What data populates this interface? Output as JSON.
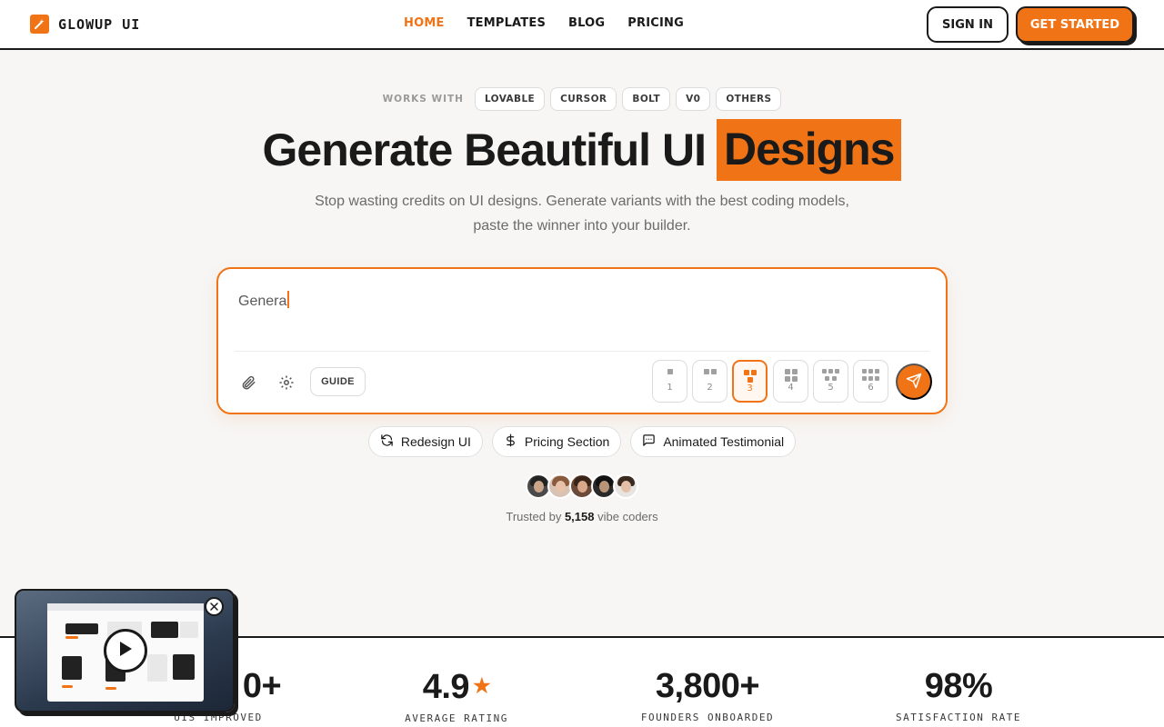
{
  "header": {
    "brand": "GLOWUP UI",
    "nav": [
      "HOME",
      "TEMPLATES",
      "BLOG",
      "PRICING"
    ],
    "active_nav": "HOME",
    "signin_label": "SIGN IN",
    "cta_label": "GET STARTED"
  },
  "works_with": {
    "label": "WORKS WITH",
    "chips": [
      "LOVABLE",
      "CURSOR",
      "BOLT",
      "V0",
      "OTHERS"
    ]
  },
  "hero": {
    "headline_main": "Generate Beautiful UI",
    "headline_highlight": "Designs",
    "subtitle": "Stop wasting credits on UI designs. Generate variants with the best coding models, paste the winner into your builder."
  },
  "prompt": {
    "value": "Genera",
    "guide_label": "GUIDE",
    "variants": [
      "1",
      "2",
      "3",
      "4",
      "5",
      "6"
    ],
    "selected_variant": "3"
  },
  "suggestions": [
    {
      "label": "Redesign UI",
      "icon": "refresh-icon"
    },
    {
      "label": "Pricing Section",
      "icon": "dollar-icon"
    },
    {
      "label": "Animated Testimonial",
      "icon": "chat-icon"
    }
  ],
  "trusted": {
    "prefix": "Trusted by",
    "count": "5,158",
    "suffix": "vibe coders"
  },
  "stats": [
    {
      "value": "0+",
      "label": "UIS IMPROVED"
    },
    {
      "value": "4.9",
      "label": "AVERAGE RATING"
    },
    {
      "value": "3,800+",
      "label": "FOUNDERS ONBOARDED"
    },
    {
      "value": "98%",
      "label": "SATISFACTION RATE"
    }
  ],
  "colors": {
    "accent": "#f07416",
    "ink": "#1a1a1a",
    "background": "#f7f6f5"
  }
}
